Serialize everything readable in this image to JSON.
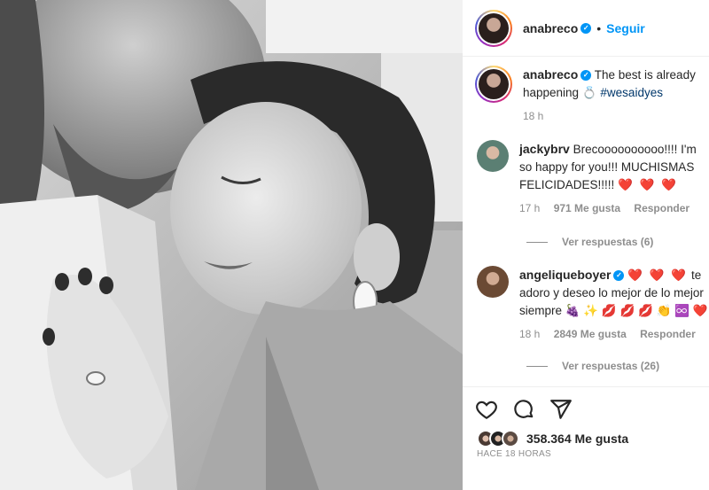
{
  "post": {
    "photo_description_icon": "engagement-photo",
    "header": {
      "username": "anabreco",
      "separator": "•",
      "follow_label": "Seguir"
    },
    "caption": {
      "username": "anabreco",
      "text": "The best is already happening",
      "emoji": "💍",
      "hashtag": "#wesaidyes",
      "time": "18 h"
    },
    "comments": [
      {
        "username": "jackybrv",
        "text": "Brecoooooooooo!!!! I'm so happy for you!!! MUCHISMAS FELICIDADES!!!!!",
        "emoji": "❤️ ❤️ ❤️",
        "time": "17 h",
        "likes": "971 Me gusta",
        "reply_label": "Responder",
        "view_replies": "Ver respuestas (6)"
      },
      {
        "username": "angeliqueboyer",
        "text_before": "te adoro y deseo lo mejor de lo mejor siempre",
        "emoji_before": "❤️ ❤️ ❤️",
        "emoji_after": "🍇 ✨ 💋 💋 💋 👏 ♾️ ❤️",
        "time": "18 h",
        "likes": "2849 Me gusta",
        "reply_label": "Responder",
        "view_replies": "Ver respuestas (26)"
      }
    ],
    "actions": {
      "like_icon": "heart-icon",
      "comment_icon": "comment-icon",
      "share_icon": "share-icon",
      "likes_count": "358.364 Me gusta",
      "posted_ago": "HACE 18 HORAS"
    },
    "colors": {
      "accent": "#0095f6",
      "heart": "#ed4956",
      "muted": "#8e8e8e"
    }
  }
}
